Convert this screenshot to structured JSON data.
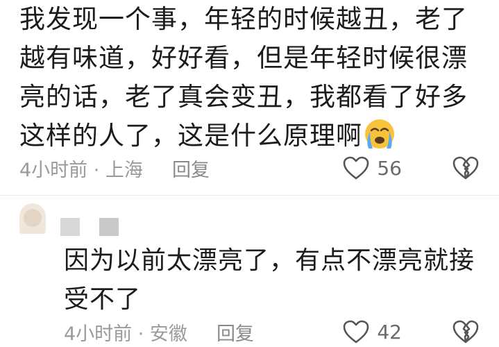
{
  "comment": {
    "text": "我发现一个事，年轻的时候越丑，老了越有味道，好好看，但是年轻时候很漂亮的话，老了真会变丑，我都看了好多这样的人了，这是什么原理啊",
    "emoji": "loudly-crying-face-icon",
    "meta": "4小时前 · 上海",
    "reply_label": "回复",
    "like_count": "56"
  },
  "reply": {
    "text": "因为以前太漂亮了，有点不漂亮就接受不了",
    "meta": "4小时前 · 安徽",
    "reply_label": "回复",
    "like_count": "42"
  },
  "colors": {
    "text": "#1c1c1c",
    "meta": "#9a9a9a",
    "emoji_face": "#f9c23c",
    "emoji_tears": "#5aa9f5"
  }
}
